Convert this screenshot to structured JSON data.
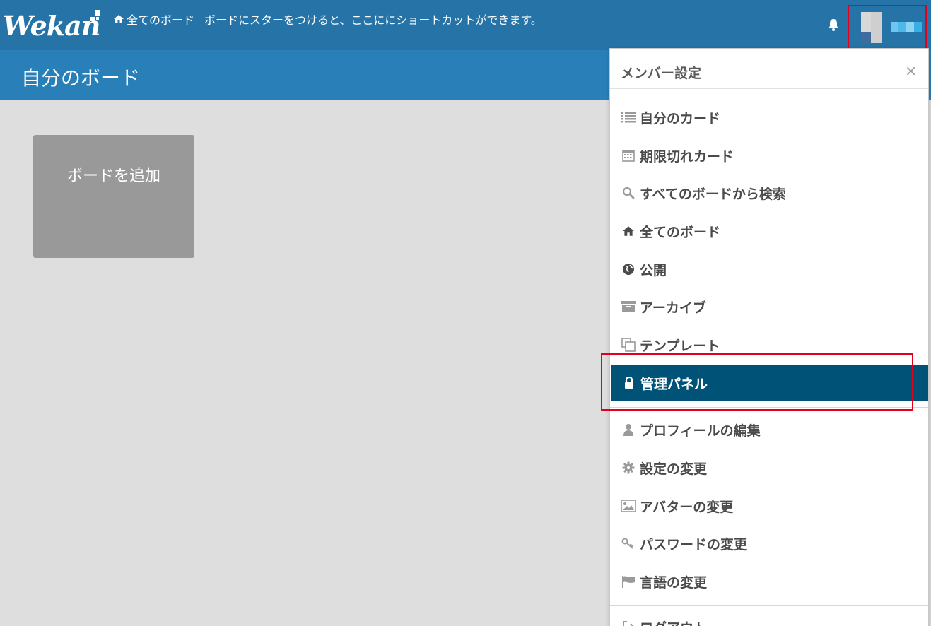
{
  "header": {
    "logo_text": "Wekan",
    "home_link": "全てのボード",
    "hint": "ボードにスターをつけると、ここににショートカットができます。"
  },
  "board": {
    "title": "自分のボード",
    "add_board_label": "ボードを追加"
  },
  "popup": {
    "title": "メンバー設定",
    "close_symbol": "×",
    "items": [
      {
        "label": "自分のカード",
        "icon": "list-icon"
      },
      {
        "label": "期限切れカード",
        "icon": "calendar-icon"
      },
      {
        "label": "すべてのボードから検索",
        "icon": "search-icon"
      },
      {
        "label": "全てのボード",
        "icon": "home-icon"
      },
      {
        "label": "公開",
        "icon": "globe-icon"
      },
      {
        "label": "アーカイブ",
        "icon": "archive-icon"
      },
      {
        "label": "テンプレート",
        "icon": "clone-icon"
      },
      {
        "label": "管理パネル",
        "icon": "lock-icon"
      },
      {
        "label": "プロフィールの編集",
        "icon": "user-icon"
      },
      {
        "label": "設定の変更",
        "icon": "gear-icon"
      },
      {
        "label": "アバターの変更",
        "icon": "picture-icon"
      },
      {
        "label": "パスワードの変更",
        "icon": "key-icon"
      },
      {
        "label": "言語の変更",
        "icon": "flag-icon"
      },
      {
        "label": "ログアウト",
        "icon": "logout-icon"
      }
    ]
  },
  "colors": {
    "header_bg": "#2573a7",
    "board_bar_bg": "#2980b9",
    "active_item_bg": "#005377",
    "highlight": "#e3001b"
  }
}
